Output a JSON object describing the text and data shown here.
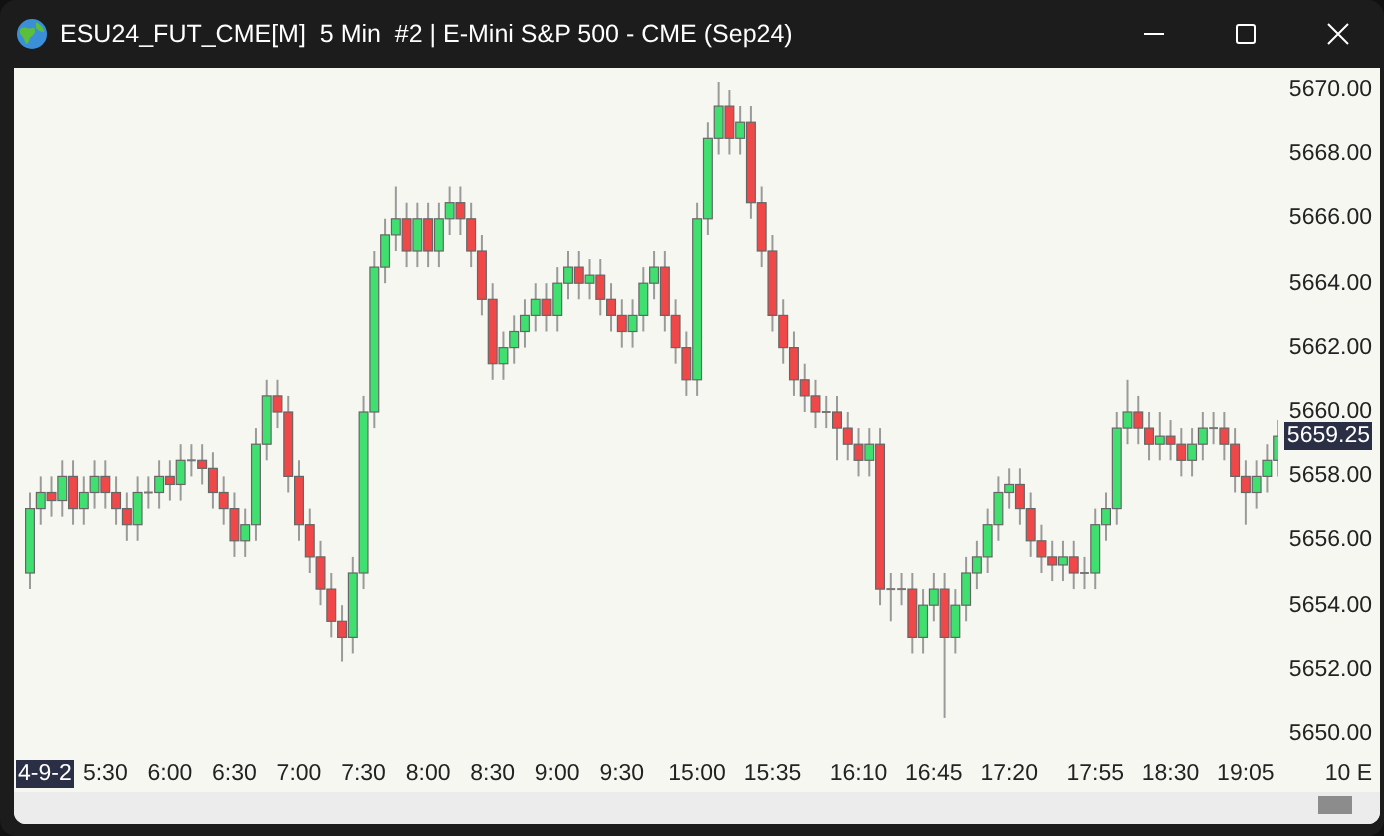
{
  "window": {
    "title": "ESU24_FUT_CME[M]  5 Min  #2 | E-Mini S&P 500 - CME (Sep24)"
  },
  "chart": {
    "current_price": "5659.25",
    "cursor_label": "4-9-2",
    "corner_label": "10 E",
    "chart_data": {
      "type": "candlestick",
      "ylim": [
        5650,
        5670
      ],
      "categories": [
        null,
        null,
        null,
        null,
        null,
        null,
        null,
        "5:30",
        null,
        null,
        null,
        null,
        null,
        "6:00",
        null,
        null,
        null,
        null,
        null,
        "6:30",
        null,
        null,
        null,
        null,
        null,
        "7:00",
        null,
        null,
        null,
        null,
        null,
        "7:30",
        null,
        null,
        null,
        null,
        null,
        "8:00",
        null,
        null,
        null,
        null,
        null,
        "8:30",
        null,
        null,
        null,
        null,
        null,
        "9:00",
        null,
        null,
        null,
        null,
        null,
        "9:30",
        null,
        null,
        null,
        null,
        null,
        null,
        "15:00",
        null,
        null,
        null,
        null,
        null,
        null,
        "15:35",
        null,
        null,
        null,
        null,
        null,
        null,
        null,
        "16:10",
        null,
        null,
        null,
        null,
        null,
        null,
        "16:45",
        null,
        null,
        null,
        null,
        null,
        null,
        "17:20",
        null,
        null,
        null,
        null,
        null,
        null,
        null,
        "17:55",
        null,
        null,
        null,
        null,
        null,
        null,
        "18:30",
        null,
        null,
        null,
        null,
        null,
        null,
        "19:05",
        null,
        null,
        null
      ],
      "ohlc": [
        [
          5655,
          5657.5,
          5654.5,
          5657
        ],
        [
          5657,
          5658,
          5656.5,
          5657.5
        ],
        [
          5657.5,
          5658,
          5656.75,
          5657.25
        ],
        [
          5657.25,
          5658.5,
          5656.75,
          5658
        ],
        [
          5658,
          5658.5,
          5656.5,
          5657
        ],
        [
          5657,
          5658,
          5656.5,
          5657.5
        ],
        [
          5657.5,
          5658.5,
          5657,
          5658
        ],
        [
          5658,
          5658.5,
          5657,
          5657.5
        ],
        [
          5657.5,
          5658,
          5656.5,
          5657
        ],
        [
          5657,
          5657.5,
          5656,
          5656.5
        ],
        [
          5656.5,
          5658,
          5656,
          5657.5
        ],
        [
          5657.5,
          5658,
          5657,
          5657.5
        ],
        [
          5657.5,
          5658.5,
          5657,
          5658
        ],
        [
          5658,
          5658.5,
          5657.25,
          5657.75
        ],
        [
          5657.75,
          5659,
          5657.25,
          5658.5
        ],
        [
          5658.5,
          5659,
          5658,
          5658.5
        ],
        [
          5658.5,
          5659,
          5657.75,
          5658.25
        ],
        [
          5658.25,
          5658.75,
          5657,
          5657.5
        ],
        [
          5657.5,
          5658,
          5656.5,
          5657
        ],
        [
          5657,
          5657.5,
          5655.5,
          5656
        ],
        [
          5656,
          5657,
          5655.5,
          5656.5
        ],
        [
          5656.5,
          5659.5,
          5656,
          5659
        ],
        [
          5659,
          5661,
          5658.5,
          5660.5
        ],
        [
          5660.5,
          5661,
          5659.5,
          5660
        ],
        [
          5660,
          5660.5,
          5657.5,
          5658
        ],
        [
          5658,
          5658.5,
          5656,
          5656.5
        ],
        [
          5656.5,
          5657,
          5655,
          5655.5
        ],
        [
          5655.5,
          5656,
          5654,
          5654.5
        ],
        [
          5654.5,
          5655,
          5653,
          5653.5
        ],
        [
          5653.5,
          5654,
          5652.25,
          5653
        ],
        [
          5653,
          5655.5,
          5652.5,
          5655
        ],
        [
          5655,
          5660.5,
          5654.5,
          5660
        ],
        [
          5660,
          5665,
          5659.5,
          5664.5
        ],
        [
          5664.5,
          5666,
          5664,
          5665.5
        ],
        [
          5665.5,
          5667,
          5665,
          5666
        ],
        [
          5666,
          5666.5,
          5664.5,
          5665
        ],
        [
          5665,
          5666.5,
          5664.5,
          5666
        ],
        [
          5666,
          5666.5,
          5664.5,
          5665
        ],
        [
          5665,
          5666.5,
          5664.5,
          5666
        ],
        [
          5666,
          5667,
          5665.5,
          5666.5
        ],
        [
          5666.5,
          5667,
          5665.5,
          5666
        ],
        [
          5666,
          5666.5,
          5664.5,
          5665
        ],
        [
          5665,
          5665.5,
          5663,
          5663.5
        ],
        [
          5663.5,
          5664,
          5661,
          5661.5
        ],
        [
          5661.5,
          5662.5,
          5661,
          5662
        ],
        [
          5662,
          5663,
          5661.5,
          5662.5
        ],
        [
          5662.5,
          5663.5,
          5662,
          5663
        ],
        [
          5663,
          5664,
          5662.5,
          5663.5
        ],
        [
          5663.5,
          5664,
          5662.5,
          5663
        ],
        [
          5663,
          5664.5,
          5662.5,
          5664
        ],
        [
          5664,
          5665,
          5663.5,
          5664.5
        ],
        [
          5664.5,
          5665,
          5663.5,
          5664
        ],
        [
          5664,
          5664.75,
          5663.5,
          5664.25
        ],
        [
          5664.25,
          5664.75,
          5663,
          5663.5
        ],
        [
          5663.5,
          5664,
          5662.5,
          5663
        ],
        [
          5663,
          5663.5,
          5662,
          5662.5
        ],
        [
          5662.5,
          5663.5,
          5662,
          5663
        ],
        [
          5663,
          5664.5,
          5662.5,
          5664
        ],
        [
          5664,
          5665,
          5663.5,
          5664.5
        ],
        [
          5664.5,
          5665,
          5662.5,
          5663
        ],
        [
          5663,
          5663.5,
          5661.5,
          5662
        ],
        [
          5662,
          5662.5,
          5660.5,
          5661
        ],
        [
          5661,
          5666.5,
          5660.5,
          5666
        ],
        [
          5666,
          5669,
          5665.5,
          5668.5
        ],
        [
          5668.5,
          5670.25,
          5668,
          5669.5
        ],
        [
          5669.5,
          5670,
          5668,
          5668.5
        ],
        [
          5668.5,
          5669.5,
          5668,
          5669
        ],
        [
          5669,
          5669.5,
          5666,
          5666.5
        ],
        [
          5666.5,
          5667,
          5664.5,
          5665
        ],
        [
          5665,
          5665.5,
          5662.5,
          5663
        ],
        [
          5663,
          5663.5,
          5661.5,
          5662
        ],
        [
          5662,
          5662.5,
          5660.5,
          5661
        ],
        [
          5661,
          5661.5,
          5660,
          5660.5
        ],
        [
          5660.5,
          5661,
          5659.5,
          5660
        ],
        [
          5660,
          5660.5,
          5659.5,
          5660
        ],
        [
          5660,
          5660.5,
          5658.5,
          5659.5
        ],
        [
          5659.5,
          5660,
          5658.5,
          5659
        ],
        [
          5659,
          5659.5,
          5658,
          5658.5
        ],
        [
          5658.5,
          5659.5,
          5658,
          5659
        ],
        [
          5659,
          5659.5,
          5654,
          5654.5
        ],
        [
          5654.5,
          5655,
          5653.5,
          5654.5
        ],
        [
          5654.5,
          5655,
          5654,
          5654.5
        ],
        [
          5654.5,
          5655,
          5652.5,
          5653
        ],
        [
          5653,
          5654.5,
          5652.5,
          5654
        ],
        [
          5654,
          5655,
          5653.5,
          5654.5
        ],
        [
          5654.5,
          5655,
          5650.5,
          5653
        ],
        [
          5653,
          5654.5,
          5652.5,
          5654
        ],
        [
          5654,
          5655.5,
          5653.5,
          5655
        ],
        [
          5655,
          5656,
          5654.5,
          5655.5
        ],
        [
          5655.5,
          5657,
          5655,
          5656.5
        ],
        [
          5656.5,
          5658,
          5656,
          5657.5
        ],
        [
          5657.5,
          5658.25,
          5657,
          5657.75
        ],
        [
          5657.75,
          5658.25,
          5656.5,
          5657
        ],
        [
          5657,
          5657.5,
          5655.5,
          5656
        ],
        [
          5656,
          5656.5,
          5655,
          5655.5
        ],
        [
          5655.5,
          5656,
          5654.75,
          5655.25
        ],
        [
          5655.25,
          5656,
          5654.75,
          5655.5
        ],
        [
          5655.5,
          5656,
          5654.5,
          5655
        ],
        [
          5655,
          5655.5,
          5654.5,
          5655
        ],
        [
          5655,
          5657,
          5654.5,
          5656.5
        ],
        [
          5656.5,
          5657.5,
          5656,
          5657
        ],
        [
          5657,
          5660,
          5656.5,
          5659.5
        ],
        [
          5659.5,
          5661,
          5659,
          5660
        ],
        [
          5660,
          5660.5,
          5659,
          5659.5
        ],
        [
          5659.5,
          5660,
          5658.5,
          5659
        ],
        [
          5659,
          5660,
          5658.5,
          5659.25
        ],
        [
          5659.25,
          5659.75,
          5658.5,
          5659
        ],
        [
          5659,
          5659.5,
          5658,
          5658.5
        ],
        [
          5658.5,
          5659.5,
          5658,
          5659
        ],
        [
          5659,
          5660,
          5658.5,
          5659.5
        ],
        [
          5659.5,
          5660,
          5659,
          5659.5
        ],
        [
          5659.5,
          5660,
          5658.5,
          5659
        ],
        [
          5659,
          5659.5,
          5657.5,
          5658
        ],
        [
          5658,
          5658.5,
          5656.5,
          5657.5
        ],
        [
          5657.5,
          5658.5,
          5657,
          5658
        ],
        [
          5658,
          5659,
          5657.5,
          5658.5
        ],
        [
          5658.5,
          5659.75,
          5658,
          5659.25
        ]
      ],
      "yticks": [
        {
          "value": 5670,
          "label": "5670.00"
        },
        {
          "value": 5668,
          "label": "5668.00"
        },
        {
          "value": 5666,
          "label": "5666.00"
        },
        {
          "value": 5664,
          "label": "5664.00"
        },
        {
          "value": 5662,
          "label": "5662.00"
        },
        {
          "value": 5660,
          "label": "5660.00"
        },
        {
          "value": 5658,
          "label": "5658.00"
        },
        {
          "value": 5656,
          "label": "5656.00"
        },
        {
          "value": 5654,
          "label": "5654.00"
        },
        {
          "value": 5652,
          "label": "5652.00"
        },
        {
          "value": 5650,
          "label": "5650.00"
        }
      ]
    }
  }
}
